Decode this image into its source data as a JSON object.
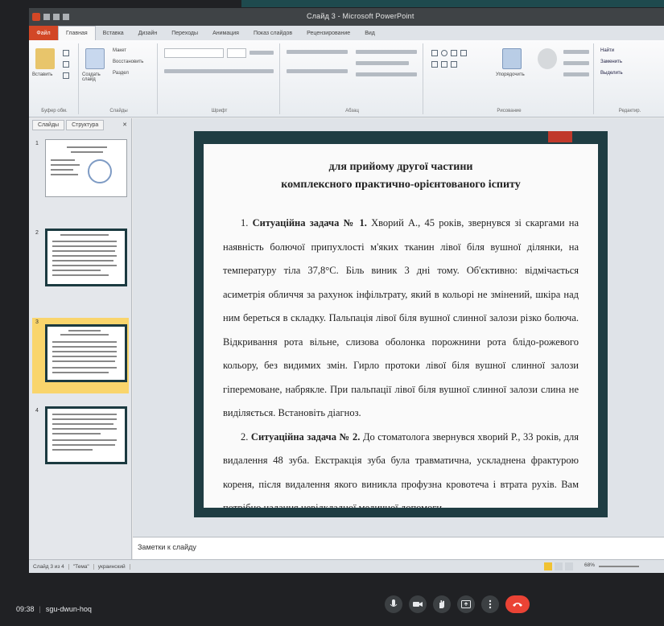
{
  "app": {
    "title": "Слайд 3 - Microsoft PowerPoint",
    "file_tab": "Файл",
    "tabs": [
      "Главная",
      "Вставка",
      "Дизайн",
      "Переходы",
      "Анимация",
      "Показ слайдов",
      "Рецензирование",
      "Вид"
    ],
    "active_tab": "Главная"
  },
  "ribbon": {
    "groups": [
      "Буфер обм.",
      "Слайды",
      "Шрифт",
      "Абзац",
      "Рисование",
      "Редактир."
    ],
    "paste_label": "Вставить",
    "create_slide_label": "Создать слайд",
    "layout_label": "Макет",
    "reset_label": "Восстановить",
    "section_label": "Раздел",
    "arrange_label": "Упорядочить",
    "find_label": "Найти",
    "replace_label": "Заменить",
    "select_label": "Выделить"
  },
  "left_pane": {
    "tab_slides": "Слайды",
    "tab_outline": "Структура",
    "close": "✕",
    "thumbnails": [
      {
        "num": "1"
      },
      {
        "num": "2"
      },
      {
        "num": "3",
        "selected": true
      },
      {
        "num": "4"
      }
    ]
  },
  "slide": {
    "title_line1": "для прийому другої частини",
    "title_line2": "комплексного практично-орієнтованого іспиту",
    "task1_label": "Ситуаційна задача № 1.",
    "task1_num": "1.",
    "task1_text": "Хворий А., 45 років, звернувся зі скаргами на наявність болючої припухлості м'яких тканин лівої біля вушної ділянки, на температуру тіла 37,8°С. Бiль виник 3 дні тому. Об'єктивно: відмічається асиметрія обличчя за рахунок інфільтрату, який в кольорі не змінений, шкіра над ним береться в складку. Пальпація лівої біля вушної слинної залози різко болюча. Відкривання рота вільне, слизова оболонка порожнини рота блідо-рожевого кольору, без видимих змін. Гирло протоки лівої біля вушної слинної залози гіперемоване, набрякле. При пальпації лівої біля вушної слинної залози слина не виділяється. Встановіть діагноз.",
    "task2_num": "2.",
    "task2_label": "Ситуаційна задача № 2.",
    "task2_text": "До стоматолога звернувся хворий Р., 33 років, для видалення 48 зуба. Екстракція зуба була травматична, ускладнена фрактурою кореня, після видалення якого виникла профузна кровотеча і втрата рухів. Вам потрібно надання невідкладної медичної допомоги."
  },
  "notes": {
    "placeholder": "Заметки к слайду"
  },
  "statusbar": {
    "slide_info": "Слайд 3 из 4",
    "theme": "\"Тема\"",
    "language": "украинский",
    "zoom": "68%"
  },
  "meet": {
    "time": "09:38",
    "separator": "|",
    "meeting_code": "sgu-dwun-hoq"
  },
  "colors": {
    "meet_bg": "#202124",
    "slide_frame": "#1f3d43",
    "accent": "#c0392b",
    "file_tab": "#d24726",
    "end_call": "#ea4335"
  }
}
